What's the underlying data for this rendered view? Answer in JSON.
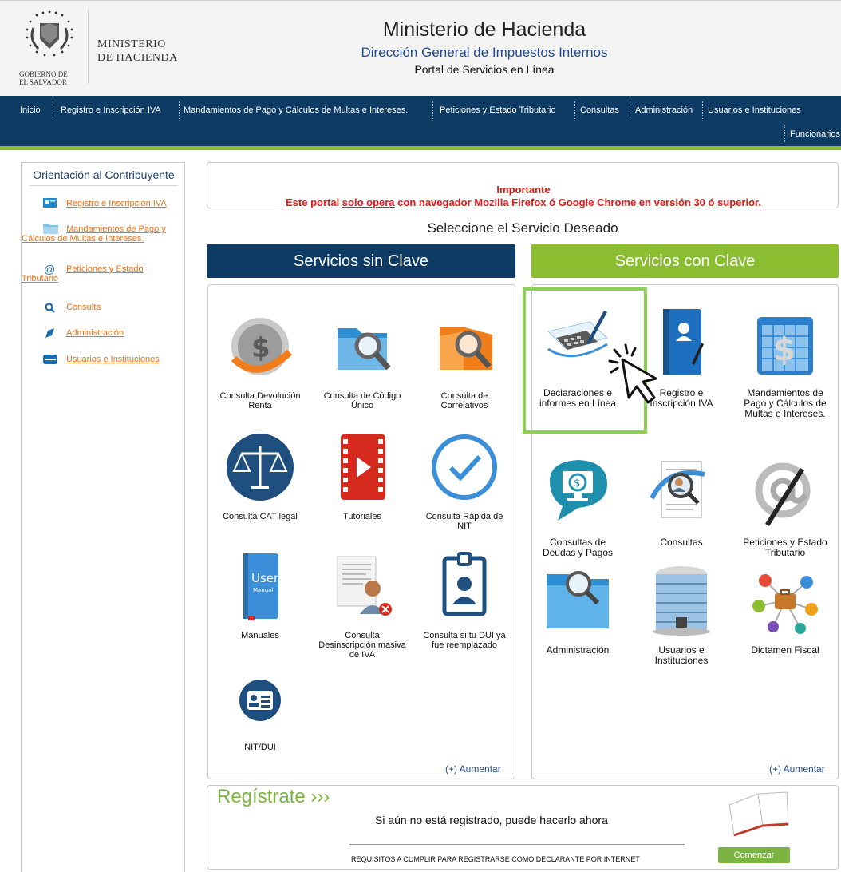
{
  "header": {
    "logo_line1": "MINISTERIO",
    "logo_line2": "DE HACIENDA",
    "gob_line1": "GOBIERNO DE",
    "gob_line2": "EL SALVADOR",
    "title": "Ministerio de Hacienda",
    "subtitle": "Dirección General de Impuestos Internos",
    "portal": "Portal de Servicios en Línea"
  },
  "nav": {
    "items": [
      "Inicio",
      "Registro e Inscripción IVA",
      "Mandamientos de Pago y Cálculos de Multas e Intereses.",
      "Peticiones y Estado Tributario",
      "Consultas",
      "Administración",
      "Usuarios e Instituciones",
      "Funcionarios"
    ]
  },
  "sidebar": {
    "title": "Orientación al Contribuyente",
    "items": [
      {
        "label": "Registro e Inscripción IVA",
        "icon": "id-card-icon"
      },
      {
        "label": "Mandamientos de Pago y Cálculos de Multas e Intereses.",
        "icon": "folder-icon"
      },
      {
        "label": "Peticiones y Estado Tributario",
        "icon": "at-sign-icon"
      },
      {
        "label": "Consulta",
        "icon": "search-icon"
      },
      {
        "label": "Administración",
        "icon": "pen-icon"
      },
      {
        "label": "Usuarios e Instituciones",
        "icon": "server-icon"
      }
    ]
  },
  "notice": {
    "title": "Importante",
    "pre": "Este portal ",
    "highlight": "solo opera",
    "post": " con navegador Mozilla Firefox ó Google Chrome en versión 30 ó superior."
  },
  "select_title": "Seleccione el Servicio Deseado",
  "servicios_sin_clave": {
    "header": "Servicios sin Clave",
    "items": [
      "Consulta Devolución Renta",
      "Consulta de Código Único",
      "Consulta de Correlativos",
      "Consulta CAT legal",
      "Tutoriales",
      "Consulta Rápida de NIT",
      "Manuales",
      "Consulta Desinscripción masiva de IVA",
      "Consulta si tu DUI ya fue reemplazado",
      "NIT/DUI"
    ],
    "more": "(+) Aumentar",
    "manual_icon_text_1": "User",
    "manual_icon_text_2": "Manual"
  },
  "servicios_con_clave": {
    "header": "Servicios con Clave",
    "items": [
      "Declaraciones e informes en Línea",
      "Registro e Inscripción IVA",
      "Mandamientos de Pago y Cálculos de Multas e Intereses.",
      "Consultas de Deudas y Pagos",
      "Consultas",
      "Peticiones y Estado Tributario",
      "Administración",
      "Usuarios e Instituciones",
      "Dictamen Fiscal"
    ],
    "more": "(+) Aumentar"
  },
  "register": {
    "title": "Regístrate ›››",
    "text": "Si aún no está registrado, puede hacerlo ahora",
    "requirements": "REQUISITOS A CUMPLIR PARA REGISTRARSE COMO DECLARANTE POR INTERNET",
    "button": "Comenzar"
  },
  "colors": {
    "navy": "#0d3b63",
    "green": "#8abd30",
    "orange_link": "#e9711c",
    "warning_red": "#e01818"
  }
}
